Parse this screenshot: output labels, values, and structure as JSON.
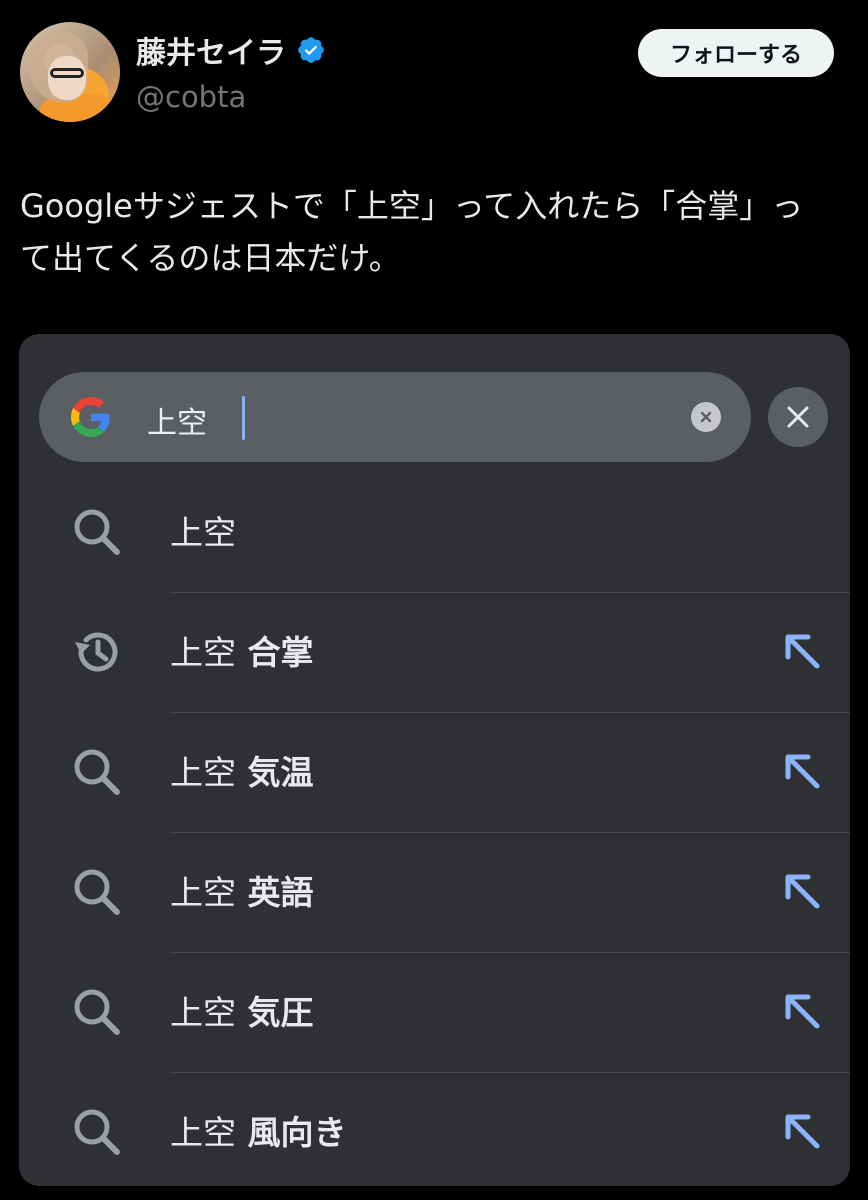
{
  "author": {
    "display_name": "藤井セイラ",
    "handle": "@cobta",
    "verified": true
  },
  "follow_button": "フォローする",
  "tweet_text": "Googleサジェストで「上空」って入れたら「合掌」って出てくるのは日本だけ。",
  "google_search": {
    "query": "上空",
    "suggestions": [
      {
        "query": "上空",
        "completion": "",
        "icon": "search-icon",
        "has_arrow": false
      },
      {
        "query": "上空",
        "completion": "合掌",
        "icon": "history-icon",
        "has_arrow": true
      },
      {
        "query": "上空",
        "completion": "気温",
        "icon": "search-icon",
        "has_arrow": true
      },
      {
        "query": "上空",
        "completion": "英語",
        "icon": "search-icon",
        "has_arrow": true
      },
      {
        "query": "上空",
        "completion": "気圧",
        "icon": "search-icon",
        "has_arrow": true
      },
      {
        "query": "上空",
        "completion": "風向き",
        "icon": "search-icon",
        "has_arrow": true
      }
    ]
  },
  "colors": {
    "background": "#000000",
    "card": "#2f3033",
    "search_field": "#5b5e62",
    "accent_arrow": "#8ab4f8",
    "verified_blue": "#1d9bf0"
  }
}
